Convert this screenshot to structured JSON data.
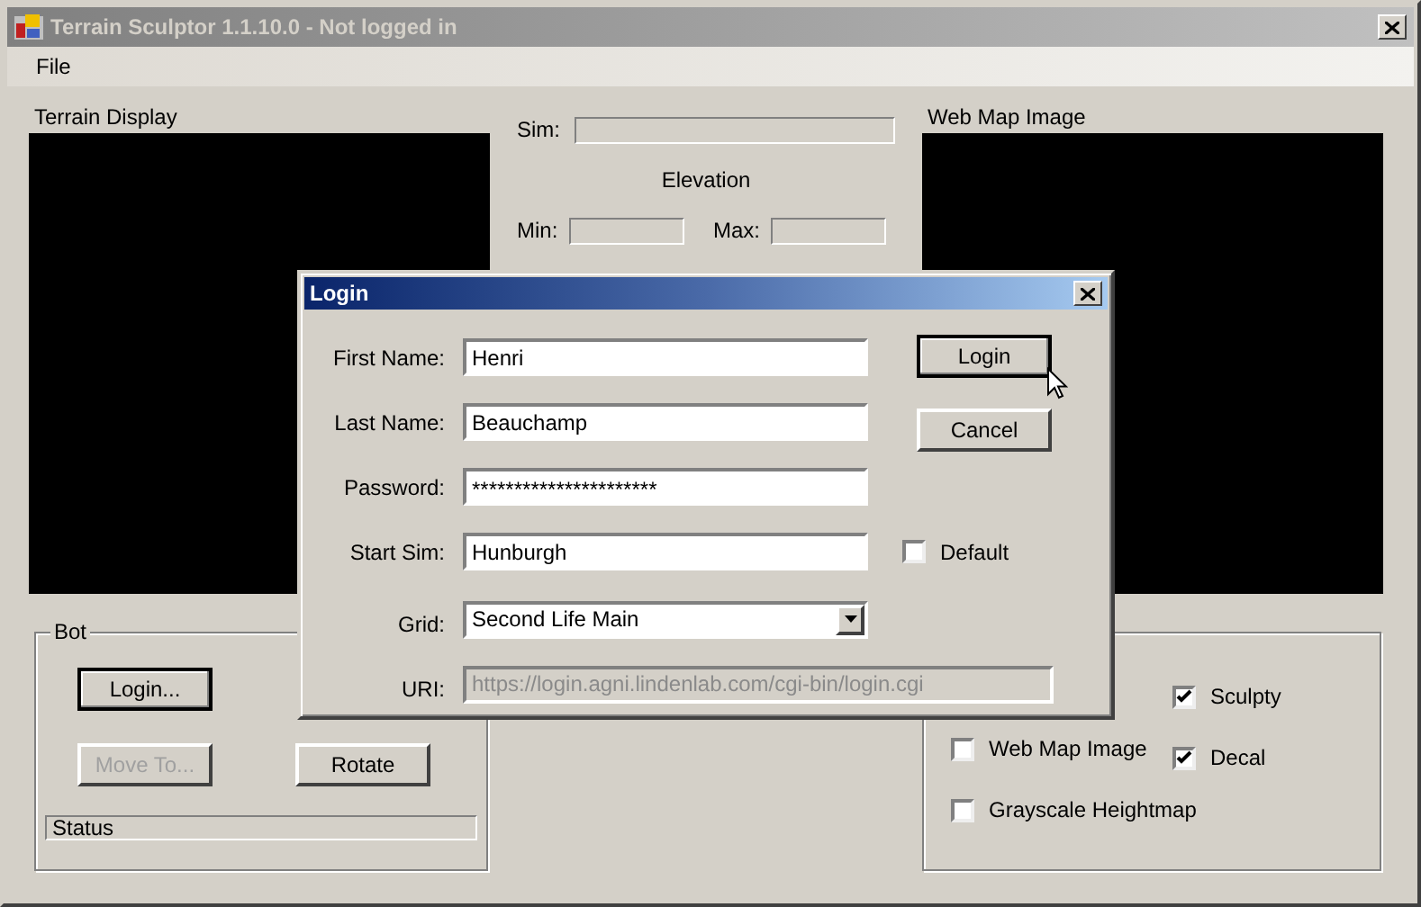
{
  "window": {
    "title": "Terrain Sculptor 1.1.10.0 - Not logged in",
    "active": false
  },
  "menu": [
    "File"
  ],
  "terrain_display": {
    "label": "Terrain Display"
  },
  "sim": {
    "label": "Sim:"
  },
  "elevation": {
    "heading": "Elevation",
    "min_label": "Min:",
    "max_label": "Max:"
  },
  "web_map": {
    "label": "Web Map Image"
  },
  "bot": {
    "title": "Bot",
    "status": "Status",
    "buttons": [
      {
        "label": "Login...",
        "disabled": false,
        "default": true
      },
      {
        "label": "Move To...",
        "disabled": true,
        "default": false
      },
      {
        "label": "Rotate",
        "disabled": false,
        "default": false
      }
    ]
  },
  "options": {
    "columns": [
      [
        {
          "label": "Web Map Image",
          "checked": false
        },
        {
          "label": "Grayscale Heightmap",
          "checked": false
        }
      ],
      [
        {
          "label": "Sculpty",
          "checked": true
        },
        {
          "label": "Decal",
          "checked": true
        }
      ]
    ]
  },
  "dialog": {
    "title": "Login",
    "active": true,
    "fields": [
      {
        "kind": "text",
        "label": "First Name:",
        "value": "Henri"
      },
      {
        "kind": "text",
        "label": "Last Name:",
        "value": "Beauchamp"
      },
      {
        "kind": "password",
        "label": "Password:",
        "value": "**********************"
      },
      {
        "kind": "text",
        "label": "Start Sim:",
        "value": "Hunburgh",
        "checkbox": {
          "label": "Default",
          "checked": false
        }
      },
      {
        "kind": "dropdown",
        "label": "Grid:",
        "value": "Second Life Main"
      },
      {
        "kind": "disabled",
        "label": "URI:",
        "value": "https://login.agni.lindenlab.com/cgi-bin/login.cgi"
      }
    ],
    "buttons": [
      {
        "label": "Login",
        "default": true
      },
      {
        "label": "Cancel",
        "default": false
      }
    ]
  }
}
